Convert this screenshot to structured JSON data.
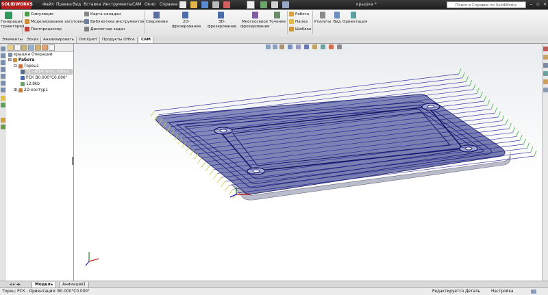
{
  "app": {
    "logo_text": "SOLIDWORKS",
    "document_title": "крышка *"
  },
  "menu": [
    "Файл",
    "Правка",
    "Вид",
    "Вставка",
    "Инструменты",
    "CAM",
    "Окно",
    "Справка"
  ],
  "search": {
    "placeholder": "Поиск в Справке по SolidWorks"
  },
  "ribbon": {
    "generate": "Генерация траектории",
    "col1": [
      "Симуляция",
      "Моделирование заготовки",
      "Постпроцессор"
    ],
    "col2": [
      "Карта наладки",
      "Библиотека инструментов",
      "Диспетчер задач"
    ],
    "big": [
      "Сверление",
      "2D-фрезерование",
      "3D-фрезерование",
      "Многоосевое фрезерование",
      "Точение"
    ],
    "col3": [
      "Работа",
      "Папка",
      "Шаблон"
    ],
    "right": [
      "Утилиты",
      "Вид",
      "Ориентация"
    ]
  },
  "tabs": [
    "Элементы",
    "Эскиз",
    "Анализировать",
    "DimXpert",
    "Продукты Office",
    "CAM"
  ],
  "active_tab": "CAM",
  "tree": {
    "root": "крышка Операции",
    "work": "Работа",
    "face": "Торец1",
    "tool": "Т1 - Ø14 mm с плоск",
    "rsk": "РСК В0.000°С0.000°",
    "size": "12.8kb",
    "contour": "2D-контур1"
  },
  "bottom_tabs": [
    "Модель",
    "Анимация1"
  ],
  "status": {
    "left": "Торец: РСК - Ориентация: В0.000°С0.000°",
    "editing": "Редактируется Деталь",
    "settings": "Настройка"
  },
  "colors": {
    "accent": "#b41c1c",
    "toolpath": "#1a1a9a",
    "part": "#7c84b4"
  }
}
